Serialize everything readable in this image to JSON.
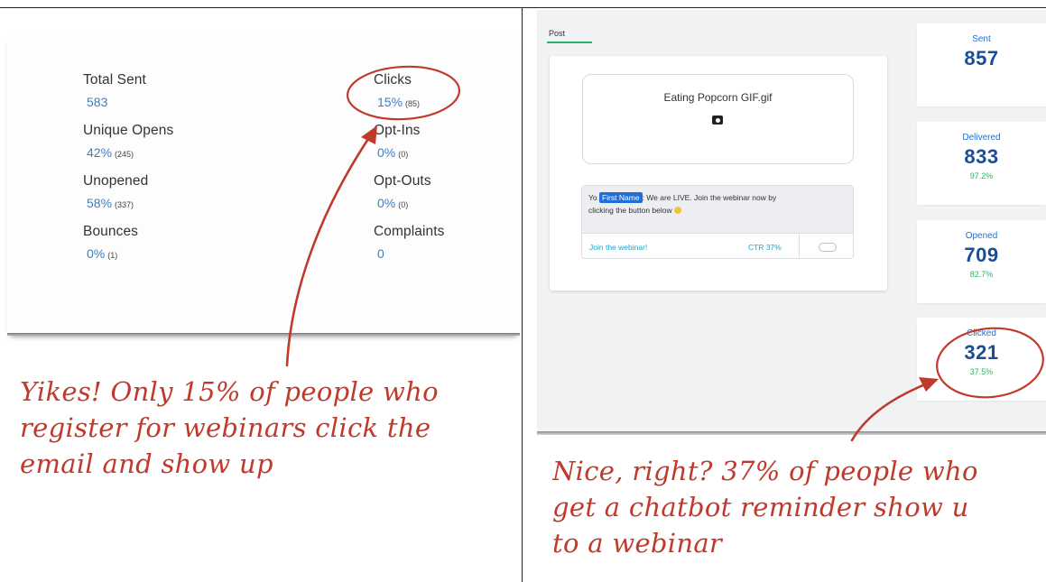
{
  "left": {
    "stats": [
      {
        "label": "Total Sent",
        "value": "583",
        "count": ""
      },
      {
        "label": "Unique Opens",
        "value": "42%",
        "count": "(245)"
      },
      {
        "label": "Unopened",
        "value": "58%",
        "count": "(337)"
      },
      {
        "label": "Bounces",
        "value": "0%",
        "count": "(1)"
      },
      {
        "label": "Clicks",
        "value": "15%",
        "count": "(85)"
      },
      {
        "label": "Opt-Ins",
        "value": "0%",
        "count": "(0)"
      },
      {
        "label": "Opt-Outs",
        "value": "0%",
        "count": "(0)"
      },
      {
        "label": "Complaints",
        "value": "0",
        "count": ""
      }
    ],
    "caption": [
      "Yikes! Only 15% of people who",
      "register for webinars click the",
      "email and show up"
    ],
    "annotation_color": "#c0392b"
  },
  "right": {
    "tab_label": "Post",
    "media_name": "Eating Popcorn GIF.gif",
    "media_icon": "camera-icon",
    "message": {
      "prefix": "Yo",
      "tag": "First Name",
      "line1_rest": ": We are LIVE. Join the webinar now by",
      "line2": "clicking the button below"
    },
    "button_label": "Join the webinar!",
    "ctr": "CTR 37%",
    "stats": [
      {
        "label": "Sent",
        "value": "857",
        "pct": ""
      },
      {
        "label": "Delivered",
        "value": "833",
        "pct": "97.2%"
      },
      {
        "label": "Opened",
        "value": "709",
        "pct": "82.7%"
      },
      {
        "label": "Clicked",
        "value": "321",
        "pct": "37.5%"
      }
    ],
    "caption": [
      "Nice, right? 37% of people who",
      "get a chatbot reminder show u",
      "to a webinar"
    ]
  }
}
